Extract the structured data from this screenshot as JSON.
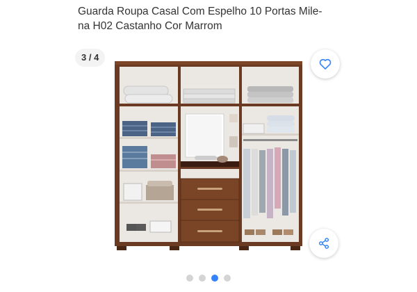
{
  "product": {
    "title_line1": "Guarda Roupa Casal Com Espelho 10 Portas Mile-",
    "title_line2": "na H02 Castanho Cor Marrom"
  },
  "gallery": {
    "counter": "3 / 4",
    "total_images": 4,
    "current_image": 3
  },
  "actions": {
    "favorite_icon": "heart-outline",
    "share_icon": "share-nodes"
  },
  "colors": {
    "accent": "#3483fa",
    "wardrobe_wood": "#6b3a22",
    "interior": "#ebe7e2"
  }
}
